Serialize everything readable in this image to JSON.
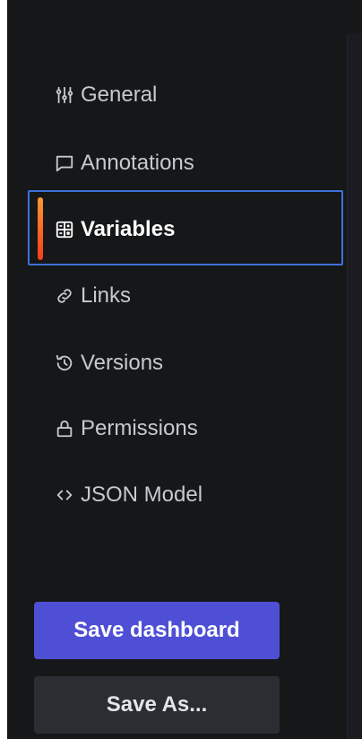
{
  "sidebar": {
    "items": [
      {
        "label": "General",
        "icon": "sliders-icon"
      },
      {
        "label": "Annotations",
        "icon": "comment-icon"
      },
      {
        "label": "Variables",
        "icon": "calculator-icon",
        "active": true
      },
      {
        "label": "Links",
        "icon": "link-icon"
      },
      {
        "label": "Versions",
        "icon": "history-icon"
      },
      {
        "label": "Permissions",
        "icon": "lock-icon"
      },
      {
        "label": "JSON Model",
        "icon": "code-icon"
      }
    ]
  },
  "actions": {
    "save_label": "Save dashboard",
    "save_as_label": "Save As..."
  },
  "colors": {
    "background": "#161719",
    "accent_blue": "#3d71d9",
    "active_indicator": "#ff7a1a",
    "primary_button": "#4f4fd6",
    "secondary_button": "#2c2d33"
  }
}
